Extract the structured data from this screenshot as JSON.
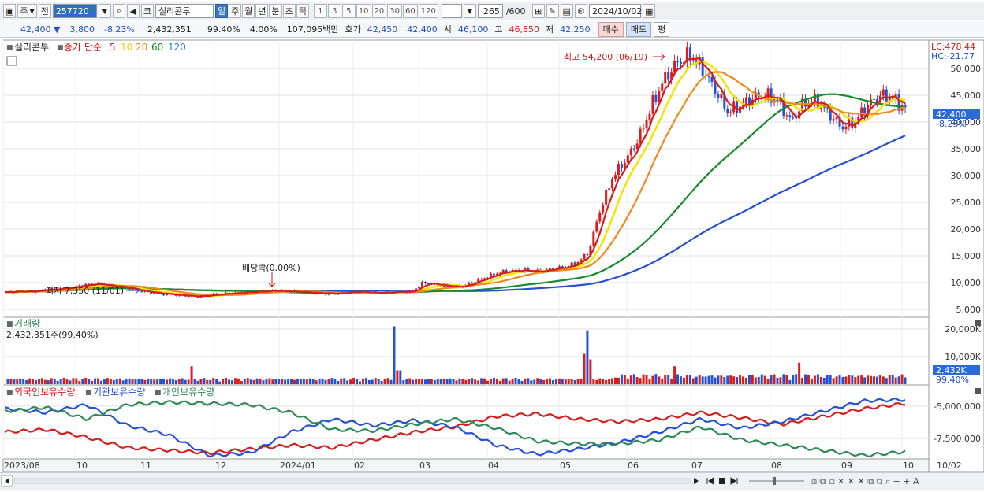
{
  "toolbar": {
    "market": "주",
    "prev": "전",
    "code": "257720",
    "type_label": "코",
    "stock_name": "실리콘투",
    "periods": [
      "일",
      "주",
      "월",
      "년",
      "분",
      "초",
      "틱"
    ],
    "selected_period": "일",
    "intervals": [
      "1",
      "3",
      "5",
      "10",
      "20",
      "30",
      "60",
      "120"
    ],
    "count": "265",
    "count_max": "/600",
    "date": "2024/10/02"
  },
  "quote": {
    "price": "42,400",
    "arrow": "▼",
    "change": "3,800",
    "change_pct": "-8.23%",
    "volume": "2,432,351",
    "volume_ratio": "99.40%",
    "turnover_pct": "4.00%",
    "trade_value": "107,095백만",
    "ask_label": "호가",
    "ask": "42,450",
    "bid": "42,400",
    "open_label": "시",
    "open": "46,100",
    "high_label": "고",
    "high": "46,850",
    "low_label": "저",
    "low": "42,250",
    "buy_label": "매수",
    "sell_label": "매도",
    "eval_label": "평"
  },
  "legend": {
    "stock": "실리콘투",
    "series_title": "종가 단순",
    "ma": [
      {
        "period": "5",
        "color": "#d71e1e"
      },
      {
        "period": "10",
        "color": "#f2e500"
      },
      {
        "period": "20",
        "color": "#f08a1a"
      },
      {
        "period": "60",
        "color": "#168c2a"
      },
      {
        "period": "120",
        "color": "#2450d6"
      }
    ],
    "lc": "LC:478.44",
    "hc": "HC:-21.77",
    "price_tag": "42,400",
    "pct_tag": "-8.23%"
  },
  "annotations": {
    "high": "최고 54,200 (06/19)",
    "low": "최저 7,350 (11/01)",
    "dividend": "배당락(0.00%)"
  },
  "volume_panel": {
    "title": "거래량",
    "value": "2,432,351주(99.40%)",
    "tag": "2,432K",
    "tag_pct": "99.40%"
  },
  "holdings_panel": {
    "series": [
      {
        "name": "외국인보유수량",
        "color": "#d71e1e"
      },
      {
        "name": "기관보유수량",
        "color": "#2450d6"
      },
      {
        "name": "개인보유수량",
        "color": "#2e8b57"
      }
    ]
  },
  "chart_data": [
    {
      "type": "line",
      "title": "실리콘투 일봉 (종가 단순 이동평균 5, 10, 20, 60, 120)",
      "x_labels": [
        "2023/08",
        "10",
        "11",
        "12",
        "2024/01",
        "02",
        "03",
        "04",
        "05",
        "06",
        "07",
        "08",
        "09",
        "10",
        "10/02"
      ],
      "ylim": [
        5000,
        55000
      ],
      "y_ticks": [
        5000,
        10000,
        15000,
        20000,
        25000,
        30000,
        35000,
        40000,
        45000,
        50000
      ],
      "y_tick_labels": [
        "5,000",
        "10,000",
        "15,000",
        "20,000",
        "25,000",
        "30,000",
        "35,000",
        "40,000",
        "45,000",
        "50,000"
      ],
      "close_series": [
        {
          "month": "2023/08",
          "values": [
            8100,
            8400,
            8300,
            8600,
            8800
          ]
        },
        {
          "month": "2023/09",
          "values": [
            9000,
            9400,
            9800,
            9500,
            9200
          ]
        },
        {
          "month": "2023/10",
          "values": [
            8800,
            8300,
            8000,
            7800,
            7600
          ]
        },
        {
          "month": "2023/11",
          "values": [
            7400,
            7600,
            7900,
            8000,
            8200
          ]
        },
        {
          "month": "2023/12",
          "values": [
            8300,
            8500,
            8400,
            8300,
            8100
          ]
        },
        {
          "month": "2024/01",
          "values": [
            8000,
            7900,
            8200,
            8300,
            8100
          ]
        },
        {
          "month": "2024/02",
          "values": [
            8100,
            8300,
            8200,
            10000,
            9600
          ]
        },
        {
          "month": "2024/03",
          "values": [
            9300,
            9200,
            10200,
            11000,
            11900
          ]
        },
        {
          "month": "2024/04",
          "values": [
            12200,
            12300,
            12000,
            12500,
            12800
          ]
        },
        {
          "month": "2024/05",
          "values": [
            13500,
            15500,
            24000,
            30000,
            33000
          ]
        },
        {
          "month": "2024/06",
          "values": [
            37000,
            43000,
            48000,
            51000,
            52500
          ]
        },
        {
          "month": "2024/07",
          "values": [
            50000,
            46000,
            42000,
            43000,
            44500
          ]
        },
        {
          "month": "2024/08",
          "values": [
            45000,
            44000,
            40000,
            43500,
            44000
          ]
        },
        {
          "month": "2024/09",
          "values": [
            41500,
            39000,
            40000,
            43000,
            45000
          ]
        },
        {
          "month": "2024/10",
          "values": [
            44500,
            42400
          ]
        }
      ],
      "series": [
        {
          "name": "5",
          "color": "#d71e1e"
        },
        {
          "name": "10",
          "color": "#f2e500"
        },
        {
          "name": "20",
          "color": "#f08a1a"
        },
        {
          "name": "60",
          "color": "#168c2a"
        },
        {
          "name": "120",
          "color": "#2450d6"
        }
      ],
      "annotations": [
        {
          "text": "최고 54,200 (06/19)",
          "value": 54200
        },
        {
          "text": "최저 7,350 (11/01)",
          "value": 7350
        },
        {
          "text": "배당락(0.00%)"
        }
      ]
    },
    {
      "type": "bar",
      "title": "거래량",
      "ylim": [
        0,
        22000
      ],
      "y_ticks": [
        10000,
        20000
      ],
      "y_tick_labels": [
        "10,000K",
        "20,000K"
      ],
      "last_value": 2432,
      "peaks": [
        {
          "month": "2024/02",
          "value": 21000
        },
        {
          "month": "2024/05",
          "value": 19500
        },
        {
          "month": "2024/08",
          "value": 7800
        }
      ]
    },
    {
      "type": "line",
      "title": "보유수량",
      "ylim": [
        -9000000,
        -3500000
      ],
      "y_ticks": [
        -5000000,
        -7500000
      ],
      "y_tick_labels": [
        "-5,000,000",
        "-7,500,000"
      ],
      "series": [
        {
          "name": "외국인보유수량",
          "color": "#d71e1e"
        },
        {
          "name": "기관보유수량",
          "color": "#2450d6"
        },
        {
          "name": "개인보유수량",
          "color": "#2e8b57"
        }
      ]
    }
  ]
}
